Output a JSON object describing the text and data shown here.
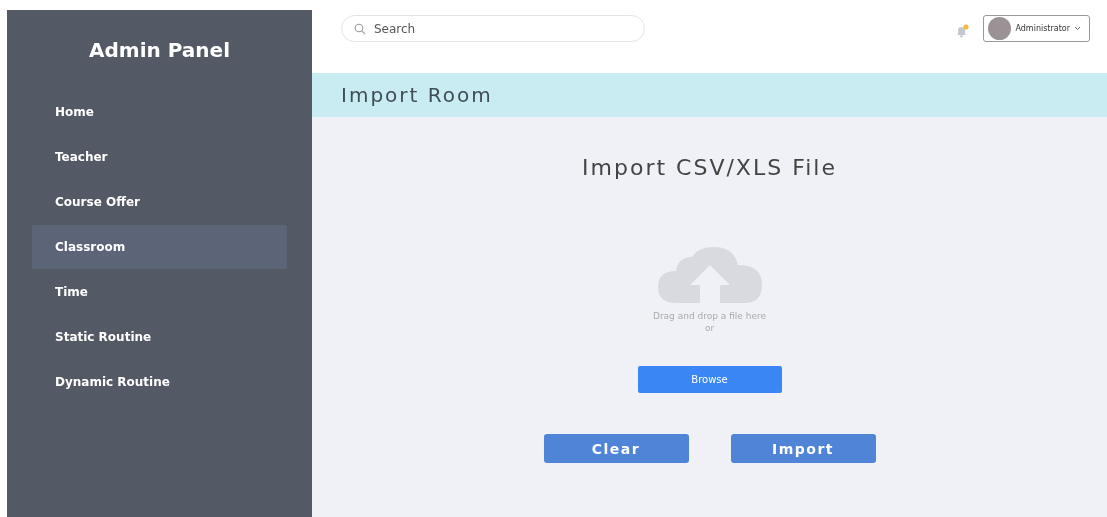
{
  "sidebar": {
    "title": "Admin Panel",
    "items": [
      {
        "label": "Home",
        "selected": false
      },
      {
        "label": "Teacher",
        "selected": false
      },
      {
        "label": "Course Offer",
        "selected": false
      },
      {
        "label": "Classroom",
        "selected": true
      },
      {
        "label": "Time",
        "selected": false
      },
      {
        "label": "Static Routine",
        "selected": false
      },
      {
        "label": "Dynamic Routine",
        "selected": false
      }
    ]
  },
  "header": {
    "search": {
      "placeholder": "Search"
    },
    "notification": {
      "unread": true
    },
    "account": {
      "label": "Administrator"
    }
  },
  "page_title": "Import Room",
  "import": {
    "heading": "Import CSV/XLS File",
    "drop_text": "Drag and drop a file here",
    "or_text": "or",
    "browse": "Browse",
    "buttons": [
      "Clear",
      "Import"
    ]
  }
}
